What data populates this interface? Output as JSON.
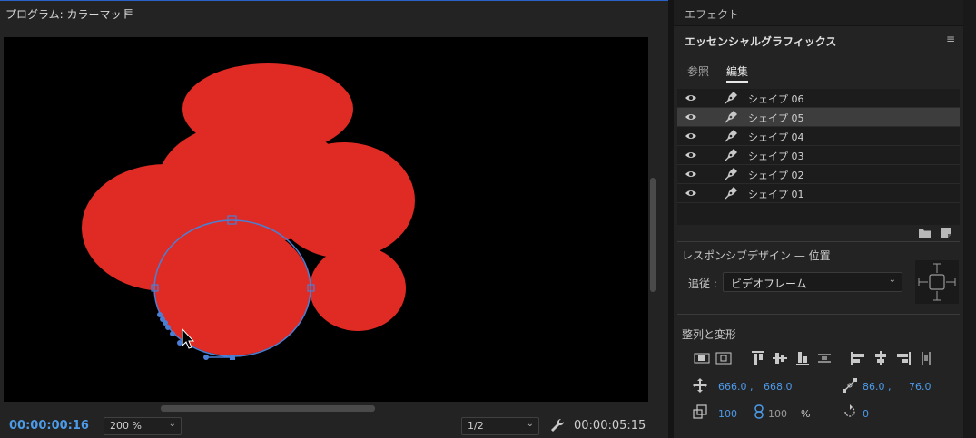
{
  "program": {
    "title": "プログラム: カラーマット",
    "menu_glyph": "≡",
    "timecode_current": "00:00:00:16",
    "zoom": "200 %",
    "resolution": "1/2",
    "timecode_duration": "00:00:05:15",
    "chevron_glyph": "⌄"
  },
  "colors": {
    "shape_fill": "#e02a24",
    "selection": "#4a7fd4",
    "accent_blue": "#4c9ae8"
  },
  "panel": {
    "effects_title": "エフェクト",
    "title": "エッセンシャルグラフィックス",
    "menu_glyph": "≡",
    "tabs": {
      "browse": "参照",
      "edit": "編集"
    },
    "layers": [
      "シェイプ 06",
      "シェイプ 05",
      "シェイプ 04",
      "シェイプ 03",
      "シェイプ 02",
      "シェイプ 01"
    ],
    "selected_layer": "シェイプ 05",
    "responsive_title": "レスポンシブデザイン — 位置",
    "follow_label": "追従 :",
    "follow_value": "ビデオフレーム",
    "align_title": "整列と変形",
    "position": {
      "x": "666.0 ,",
      "y": "668.0"
    },
    "anchor": {
      "x": "86.0 ,",
      "y": "76.0"
    },
    "scale": {
      "value": "100",
      "linked": "100",
      "unit": "%"
    },
    "rotation": "0"
  }
}
